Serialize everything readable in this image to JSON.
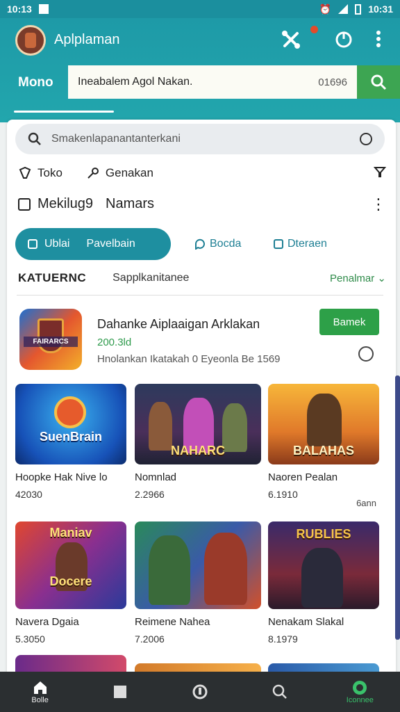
{
  "status_bar": {
    "time_left": "10:13",
    "time_right": "10:31"
  },
  "header": {
    "app_title": "Aplplaman",
    "tab_label": "Mono",
    "search_value": "Ineabalem Agol Nakan.",
    "search_code": "01696"
  },
  "sheet": {
    "search_placeholder": "Smakenlapanantanterkani",
    "chips": [
      "Toko",
      "Genakan"
    ],
    "section_title": "Mekilug9",
    "section_title_2": "Namars",
    "pill_labels": [
      "Ublai",
      "Pavelbain"
    ],
    "link_tabs": [
      "Bocda",
      "Dteraen"
    ],
    "category_label": "KATUERNC",
    "category_sub": "Sapplkanitanee",
    "sort_label": "Penalmar"
  },
  "featured": {
    "icon_text": "FAIRARCS",
    "title": "Dahanke Aiplaaigan Arklakan",
    "subtitle": "200.3ld",
    "description": "Hnolankan Ikatakah 0 Eyeonla Be 1569",
    "get_label": "Bamek"
  },
  "cards": [
    {
      "art": "SuenBrain",
      "name": "Hoopke Hak Nive lo",
      "meta": "42030",
      "extra": ""
    },
    {
      "art": "NAHARC",
      "name": "Nomnlad",
      "meta": "2.2966",
      "extra": ""
    },
    {
      "art": "BALAHAS",
      "name": "Naoren Pealan",
      "meta": "6.1910",
      "extra": "6ann"
    },
    {
      "art": "Docere",
      "name": "Navera Dgaia",
      "meta": "5.3050",
      "extra": ""
    },
    {
      "art": "",
      "name": "Reimene Nahea",
      "meta": "7.2006",
      "extra": ""
    },
    {
      "art": "RUBLIES",
      "name": "Nenakam Slakal",
      "meta": "8.1979",
      "extra": ""
    }
  ],
  "bottom_nav": [
    "Bolle",
    "",
    "",
    "",
    "Iconnee"
  ],
  "colors": {
    "teal": "#1e9aa7",
    "green": "#2da048",
    "nav_bg": "#2b2f31"
  }
}
